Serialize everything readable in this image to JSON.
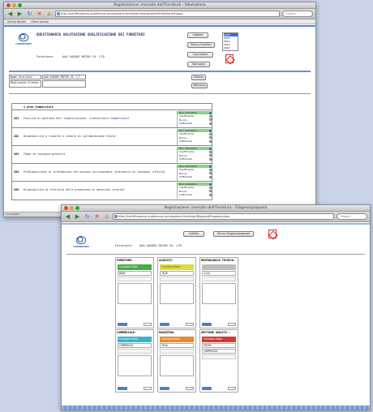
{
  "window1": {
    "title": "Registrazione: mercato dell'Fornitura - Valutazione",
    "url": "http://certificazione.qualimova.com/sezione-fornitore/valutazione/frmSezione9.aspx",
    "search_placeholder": "Google",
    "bookmarks": [
      "Ultime Notizie",
      "Ultimi articoli"
    ],
    "logo_text": "LORENZONI",
    "page_title": "QUESTIONARIO VALUTAZIONE QUALIFICAZIONE DEI FORNITORI",
    "supplier_label": "Fornitore:",
    "supplier_value": "AAA AUSONI MOTOR CO. LTD",
    "buttons": [
      "Indietro",
      "Elenco Fornitori",
      "Concludere",
      "Stampare"
    ],
    "year_list": [
      "2009",
      "2010",
      "2011",
      "2012",
      "2013"
    ],
    "form_labels": [
      "Nome Fornitore",
      "Realizzato Cliente"
    ],
    "form_value": "AAA AUSONI MOTOR CO. LT",
    "side_buttons": [
      "Modulo",
      "Welcome"
    ],
    "section_title": "1 Area Commerciale",
    "question_codes": [
      "201",
      "202",
      "203",
      "204",
      "205"
    ],
    "questions": [
      "Facilita di gestione dell'organizzazione, riconoscibile Commerciale?",
      "Disponibilita a rispetto e stabile di collaborazione futura",
      "Tempi di consegna garantiti",
      "Predisposizione di informazioni che possono corrispondere (ordinativi di consegna, offerta)",
      "Disponibilita di fornitura della produzione di materiale interno?"
    ],
    "options": [
      "Non valutabile",
      "Insufficiente",
      "Buono",
      "Sufficiente"
    ],
    "status": "Completato"
  },
  "window2": {
    "title": "Registrazione: mercato dell'Fornitura - Diagnosiproposta",
    "url": "http://certificazione.qualimova.com/sezione-fornitore/DiagnosiProposta.aspx",
    "search_placeholder": "Google",
    "buttons": [
      "Indietro",
      "Elenco Diagnosiproposte"
    ],
    "logo_text": "LORENZONI",
    "supplier_label": "Fornitore:",
    "supplier_value": "AAA AUSONI MOTOR CO. LTD",
    "areas": [
      {
        "title": "FORNITORE:",
        "bar_label": "Fornitore Note",
        "bar_color": "#46ad3f",
        "fields": [
          "MARE",
          "",
          ""
        ]
      },
      {
        "title": "ACQUISTI:",
        "bar_label": "Fornitore Note",
        "bar_color": "#dddd33",
        "fields": [
          "7020",
          "",
          ""
        ]
      },
      {
        "title": "RESPONSABILE TECNICO:",
        "bar_label": "",
        "bar_color": "#bdbdbd",
        "fields": [
          "1244",
          "",
          ""
        ]
      },
      {
        "title": "COMMERCIALE:",
        "bar_label": "Fornitore Note",
        "bar_color": "#39b5c9",
        "fields": [
          "COMPRESSO",
          "",
          ""
        ]
      },
      {
        "title": "MAGAZZINO:",
        "bar_label": "Fornitore Note",
        "bar_color": "#e98a2c",
        "fields": [
          "7010",
          "",
          ""
        ]
      },
      {
        "title": "GESTIONE QUALITA':",
        "bar_label": "Fornitore Note",
        "bar_color": "#d33a2f",
        "fields": [
          "PRIMA",
          "COMPRESSO",
          ""
        ]
      }
    ]
  }
}
